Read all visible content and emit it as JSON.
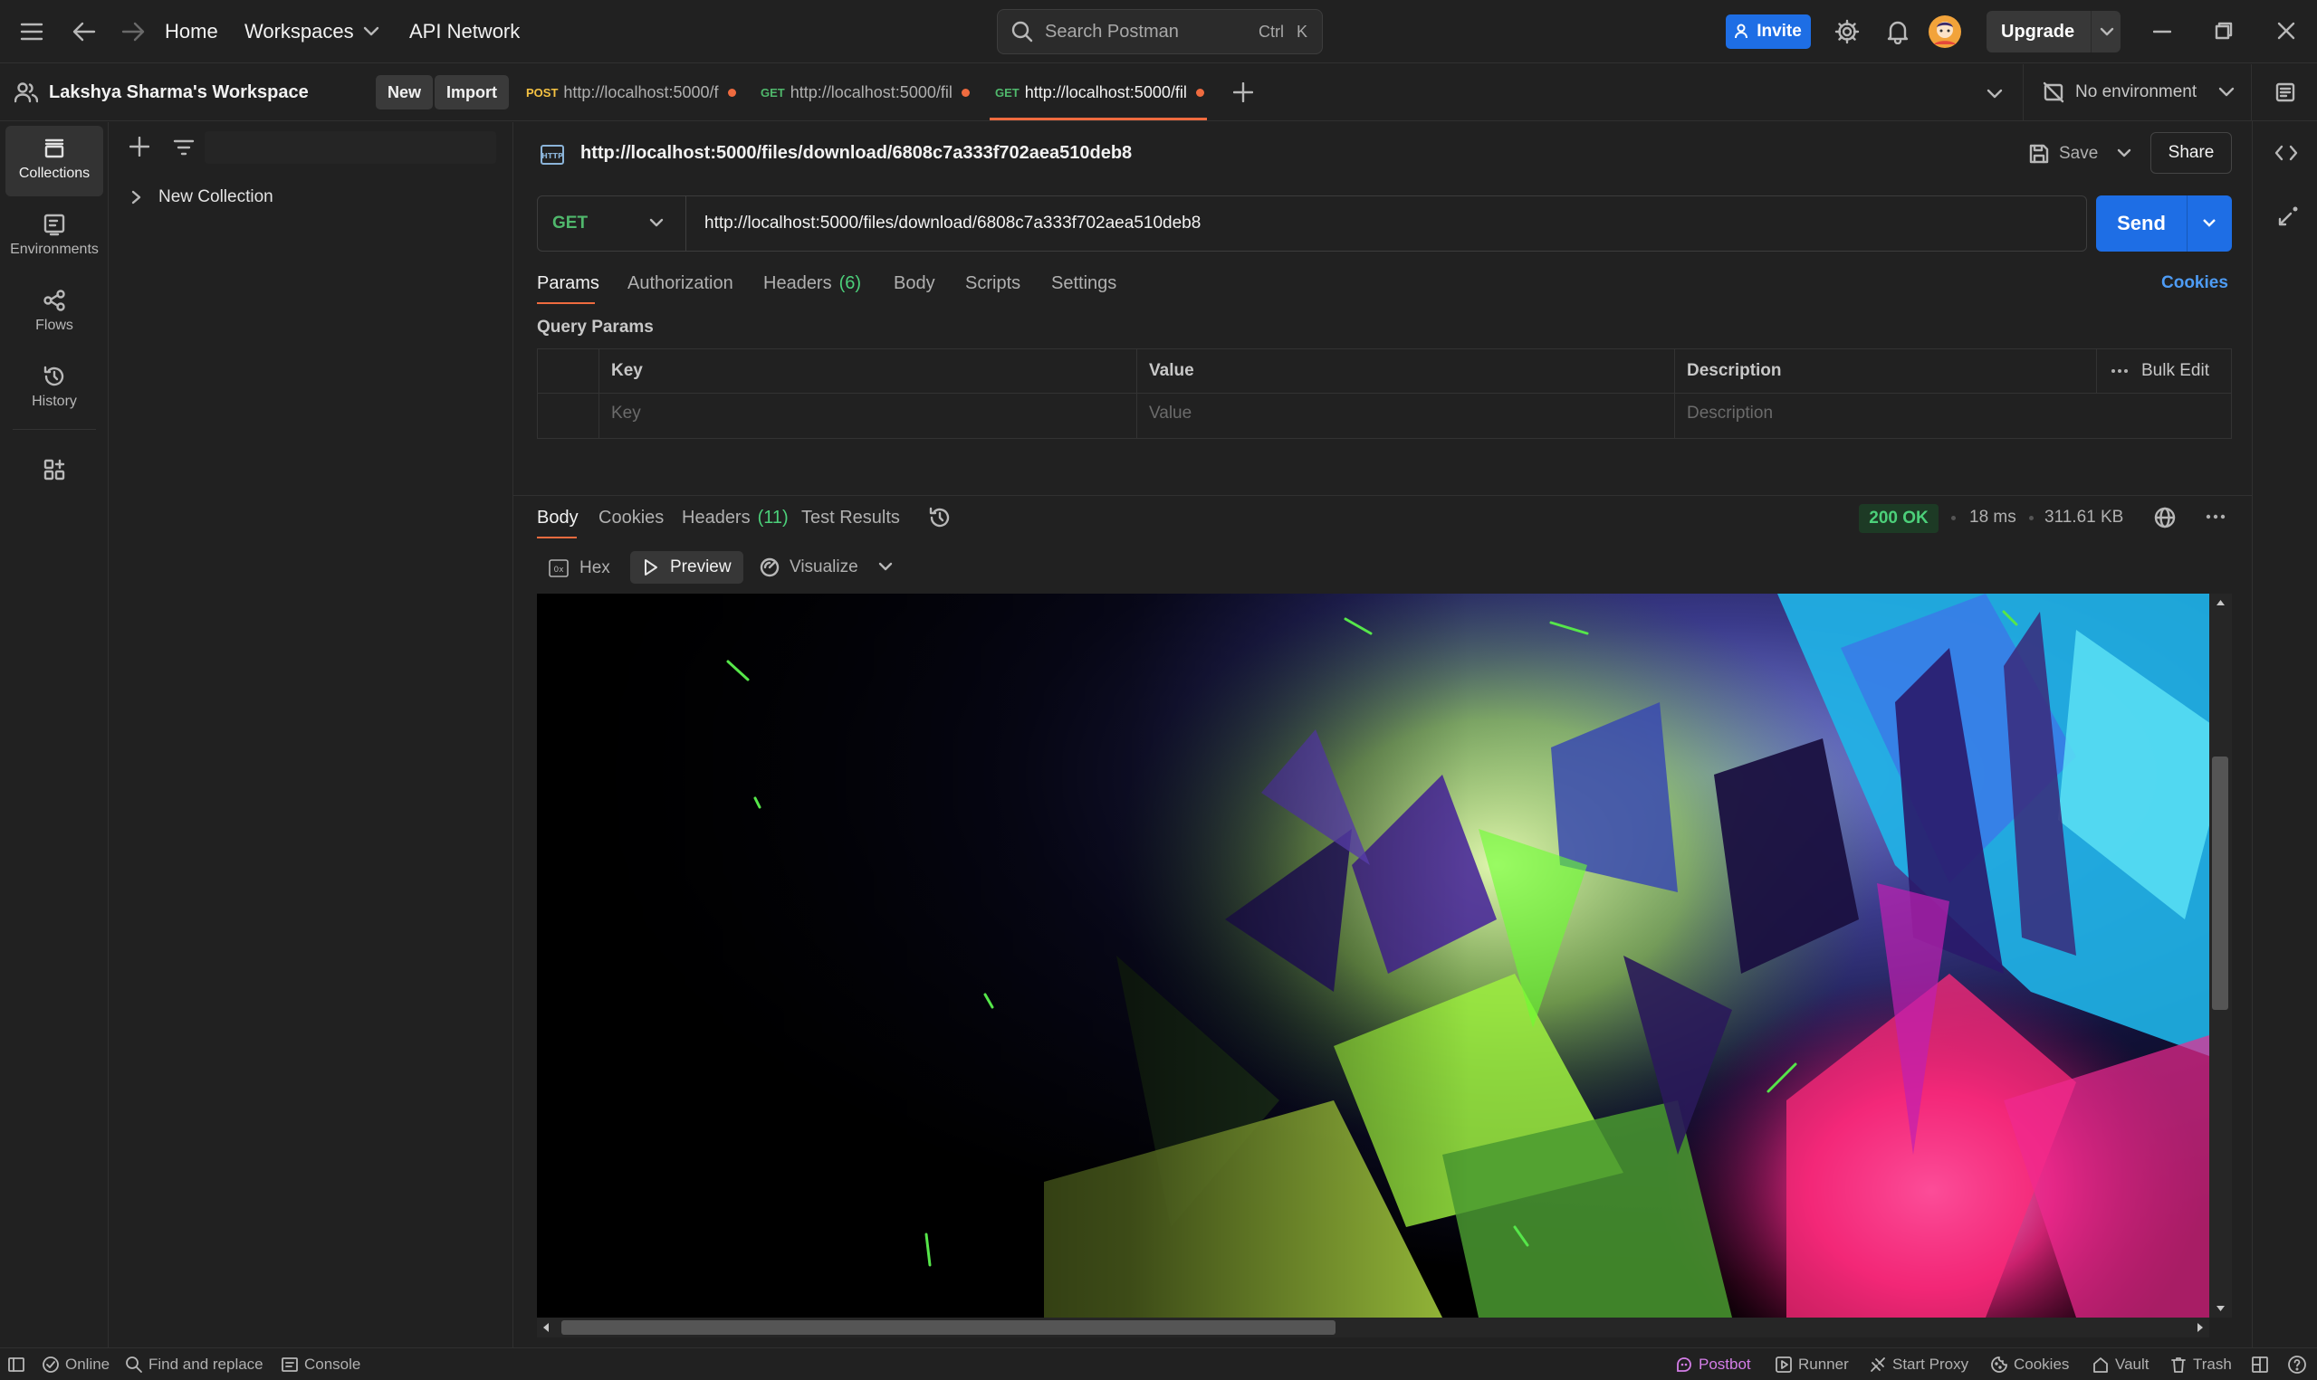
{
  "titlebar": {
    "nav": {
      "home": "Home",
      "workspaces": "Workspaces",
      "api_network": "API Network"
    },
    "search": {
      "placeholder": "Search Postman",
      "shortcut_ctrl": "Ctrl",
      "shortcut_key": "K"
    },
    "invite_label": "Invite",
    "upgrade_label": "Upgrade"
  },
  "workspace": {
    "name": "Lakshya Sharma's Workspace",
    "new_label": "New",
    "import_label": "Import"
  },
  "tabs": [
    {
      "method": "POST",
      "method_color": "#f5c242",
      "label": "http://localhost:5000/f",
      "unsaved": true,
      "active": false
    },
    {
      "method": "GET",
      "method_color": "#50b86c",
      "label": "http://localhost:5000/fil",
      "unsaved": true,
      "active": false
    },
    {
      "method": "GET",
      "method_color": "#50b86c",
      "label": "http://localhost:5000/fil",
      "unsaved": true,
      "active": true
    }
  ],
  "environment": {
    "label": "No environment"
  },
  "leftnav": {
    "items": [
      {
        "label": "Collections",
        "icon": "collections-icon",
        "active": true
      },
      {
        "label": "Environments",
        "icon": "environments-icon",
        "active": false
      },
      {
        "label": "Flows",
        "icon": "flows-icon",
        "active": false
      },
      {
        "label": "History",
        "icon": "history-icon",
        "active": false
      }
    ]
  },
  "sidebar": {
    "collections": [
      {
        "name": "New Collection"
      }
    ]
  },
  "request": {
    "title": "http://localhost:5000/files/download/6808c7a333f702aea510deb8",
    "save_label": "Save",
    "share_label": "Share",
    "method": "GET",
    "url": "http://localhost:5000/files/download/6808c7a333f702aea510deb8",
    "send_label": "Send",
    "tabs": {
      "params": "Params",
      "authorization": "Authorization",
      "headers": "Headers",
      "headers_count": "(6)",
      "body": "Body",
      "scripts": "Scripts",
      "settings": "Settings"
    },
    "cookies_link": "Cookies",
    "query_params_title": "Query Params",
    "table": {
      "headers": {
        "key": "Key",
        "value": "Value",
        "description": "Description",
        "bulk_edit": "Bulk Edit"
      },
      "placeholders": {
        "key": "Key",
        "value": "Value",
        "description": "Description"
      }
    }
  },
  "response": {
    "tabs": {
      "body": "Body",
      "cookies": "Cookies",
      "headers": "Headers",
      "headers_count": "(11)",
      "test_results": "Test Results"
    },
    "status": "200 OK",
    "time": "18 ms",
    "size": "311.61 KB",
    "view_modes": {
      "hex": "Hex",
      "preview": "Preview",
      "visualize": "Visualize"
    }
  },
  "footer": {
    "online": "Online",
    "find_replace": "Find and replace",
    "console": "Console",
    "postbot": "Postbot",
    "runner": "Runner",
    "start_proxy": "Start Proxy",
    "cookies": "Cookies",
    "vault": "Vault",
    "trash": "Trash"
  },
  "colors": {
    "accent": "#1e6ee5",
    "active_tab_underline": "#ef6b3f",
    "status_ok": "#4cd07a",
    "get_method": "#50b86c",
    "post_method": "#f5c242"
  }
}
